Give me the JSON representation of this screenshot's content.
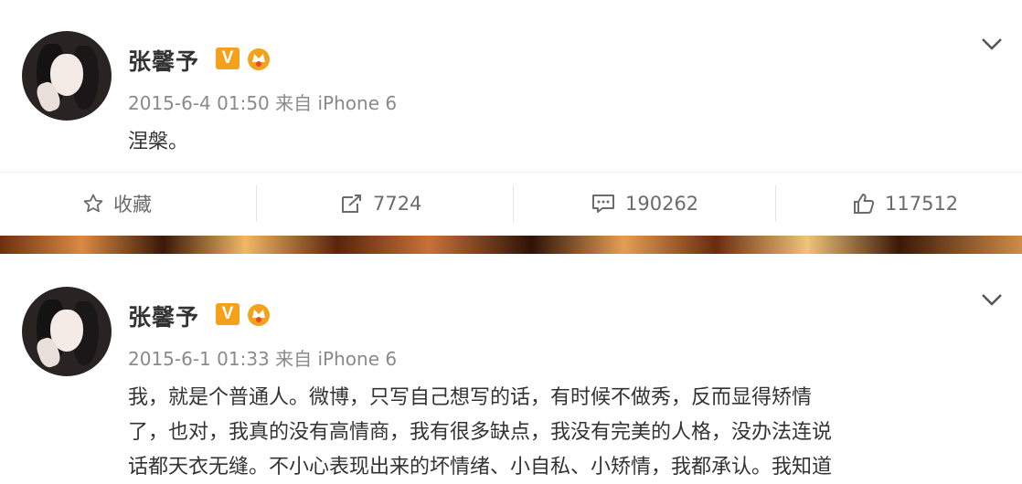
{
  "posts": [
    {
      "username": "张馨予",
      "verified_badge": "V",
      "meta": "2015-6-4 01:50 来自 iPhone 6",
      "content": "涅槃。",
      "actions": {
        "favorite_label": "收藏",
        "repost_count": "7724",
        "comment_count": "190262",
        "like_count": "117512"
      }
    },
    {
      "username": "张馨予",
      "verified_badge": "V",
      "meta": "2015-6-1 01:33 来自 iPhone 6",
      "content_lines": [
        "我，就是个普通人。微博，只写自己想写的话，有时候不做秀，反而显得矫情",
        "了，也对，我真的没有高情商，我有很多缺点，我没有完美的人格，没办法连说",
        "话都天衣无缝。不小心表现出来的坏情绪、小自私、小矫情，我都承认。我知道"
      ]
    }
  ],
  "colors": {
    "badge": "#f5a11c",
    "crown": "#e8462d",
    "text": "#333333",
    "meta": "#8a8a8a"
  },
  "icons": [
    "star-icon",
    "repost-icon",
    "comment-icon",
    "like-icon",
    "chevron-down-icon",
    "crown-icon"
  ]
}
